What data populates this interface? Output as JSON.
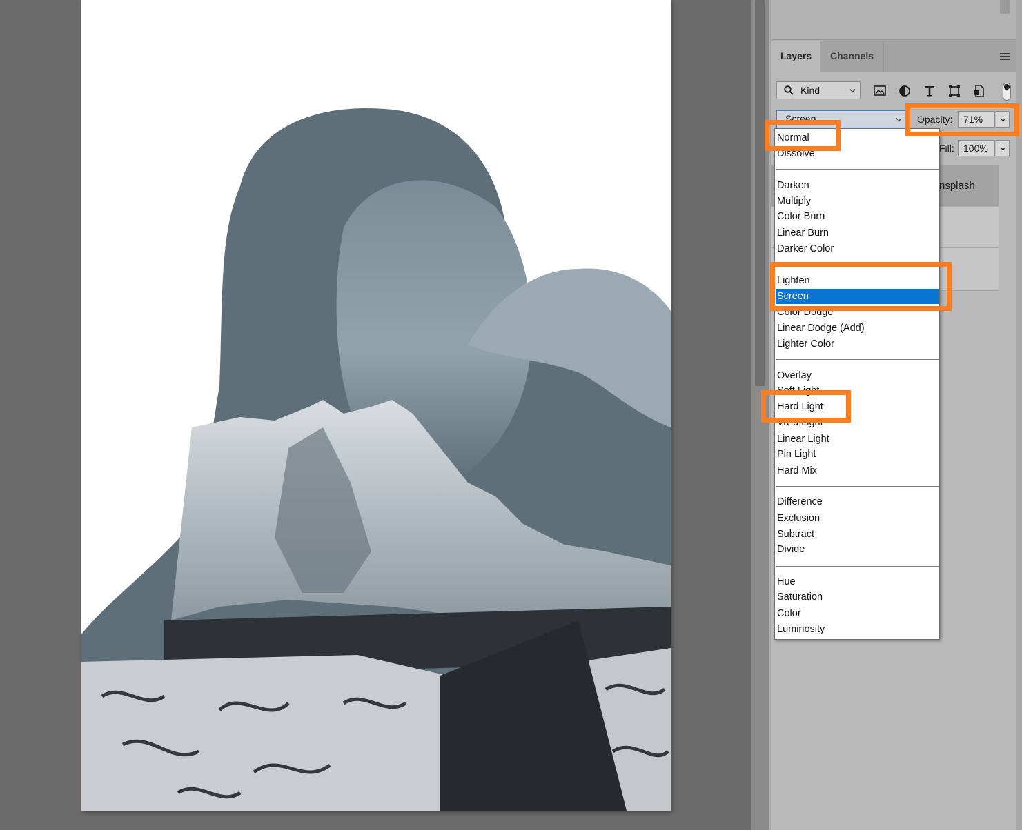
{
  "colors": {
    "workspace": "#6b6b6b",
    "panel": "#b9b9b9",
    "selection": "#0a74d4",
    "highlight": "#fb7f22"
  },
  "panel": {
    "tabs": [
      {
        "label": "Layers",
        "active": true
      },
      {
        "label": "Channels",
        "active": false
      }
    ],
    "menu_icon": "hamburger-icon"
  },
  "filter": {
    "kind_label": "Kind",
    "icons": [
      "image-filter-icon",
      "adjustment-filter-icon",
      "type-filter-icon",
      "shape-filter-icon",
      "smart-object-filter-icon"
    ]
  },
  "blend": {
    "current": "Screen",
    "opacity_label": "Opacity:",
    "opacity_value": "71%",
    "fill_label": "Fill:",
    "fill_value": "100%"
  },
  "layers": [
    {
      "name": "nsplash",
      "selected": true
    },
    {
      "name": "",
      "selected": false
    },
    {
      "name": "",
      "selected": false
    }
  ],
  "blend_modes": [
    [
      "Normal",
      "Dissolve"
    ],
    [
      "Darken",
      "Multiply",
      "Color Burn",
      "Linear Burn",
      "Darker Color"
    ],
    [
      "Lighten",
      "Screen",
      "Color Dodge",
      "Linear Dodge (Add)",
      "Lighter Color"
    ],
    [
      "Overlay",
      "Soft Light",
      "Hard Light",
      "Vivid Light",
      "Linear Light",
      "Pin Light",
      "Hard Mix"
    ],
    [
      "Difference",
      "Exclusion",
      "Subtract",
      "Divide"
    ],
    [
      "Hue",
      "Saturation",
      "Color",
      "Luminosity"
    ]
  ],
  "highlighted": [
    "Normal",
    "Lighten",
    "Screen",
    "Hard Light",
    "Opacity"
  ]
}
